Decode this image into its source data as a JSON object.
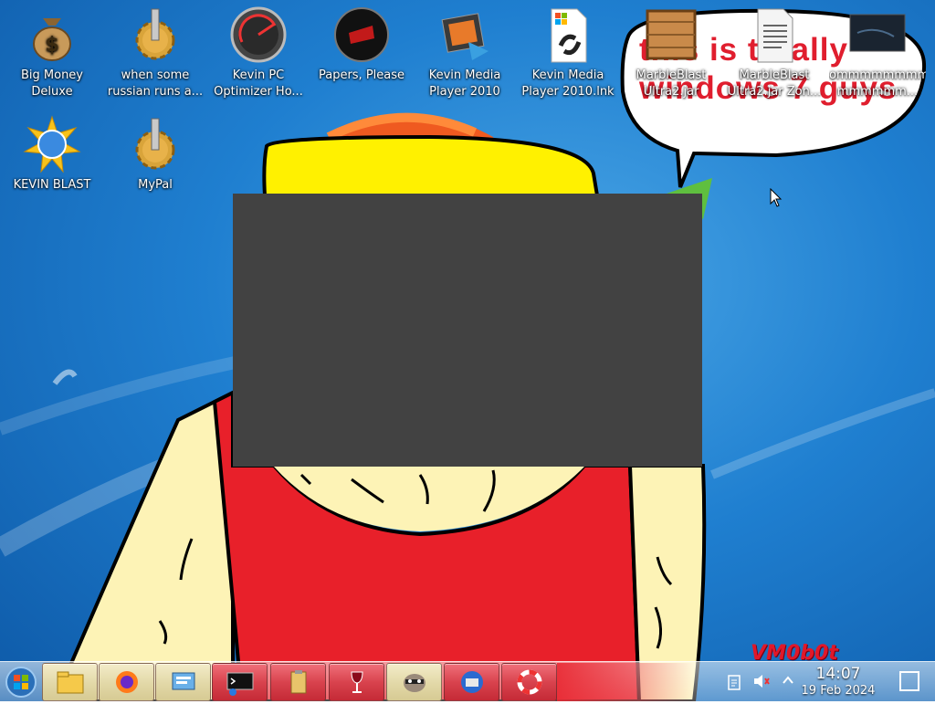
{
  "desktop_icons": [
    {
      "label": "Big Money Deluxe",
      "icon": "money-bag-icon"
    },
    {
      "label": "when some russian runs a...",
      "icon": "gear-icon"
    },
    {
      "label": "Kevin PC Optimizer Ho...",
      "icon": "speedometer-icon"
    },
    {
      "label": "Papers, Please",
      "icon": "papers-please-icon"
    },
    {
      "label": "Kevin Media Player 2010",
      "icon": "film-reel-icon"
    },
    {
      "label": "Kevin Media Player 2010.lnk",
      "icon": "shortcut-file-icon"
    },
    {
      "label": "MarbleBlast Ultra2.jar",
      "icon": "wooden-crate-icon"
    },
    {
      "label": "MarbleBlast Ultra2.jar Zon...",
      "icon": "text-file-icon"
    },
    {
      "label": "ommmmmmmm mmmmmm...",
      "icon": "image-thumbnail-icon"
    },
    {
      "label": "KEVIN BLAST",
      "icon": "globe-burst-icon"
    },
    {
      "label": "MyPal",
      "icon": "gear-icon"
    }
  ],
  "speech_bubble_text": "this is totally windows 7 guys",
  "signature": "VM0b0t",
  "taskbar": {
    "start_icon": "windows-orb-icon",
    "tasks": [
      {
        "icon": "file-explorer-icon"
      },
      {
        "icon": "firefox-icon"
      },
      {
        "icon": "control-panel-icon"
      },
      {
        "icon": "terminal-icon"
      },
      {
        "icon": "clipboard-icon"
      },
      {
        "icon": "wine-glass-icon"
      },
      {
        "icon": "raccoon-icon"
      },
      {
        "icon": "thunderbird-icon"
      },
      {
        "icon": "lifebuoy-icon"
      }
    ]
  },
  "tray": {
    "icons": [
      "clipboard-tray-icon",
      "volume-muted-icon",
      "chevron-up-icon"
    ],
    "time": "14:07",
    "date": "19 Feb 2024",
    "show_desktop_icon": "show-desktop-icon"
  },
  "colors": {
    "taskbar_task_active": "#d9434e",
    "signature": "#e0182a",
    "speech_text": "#e01e2e"
  }
}
